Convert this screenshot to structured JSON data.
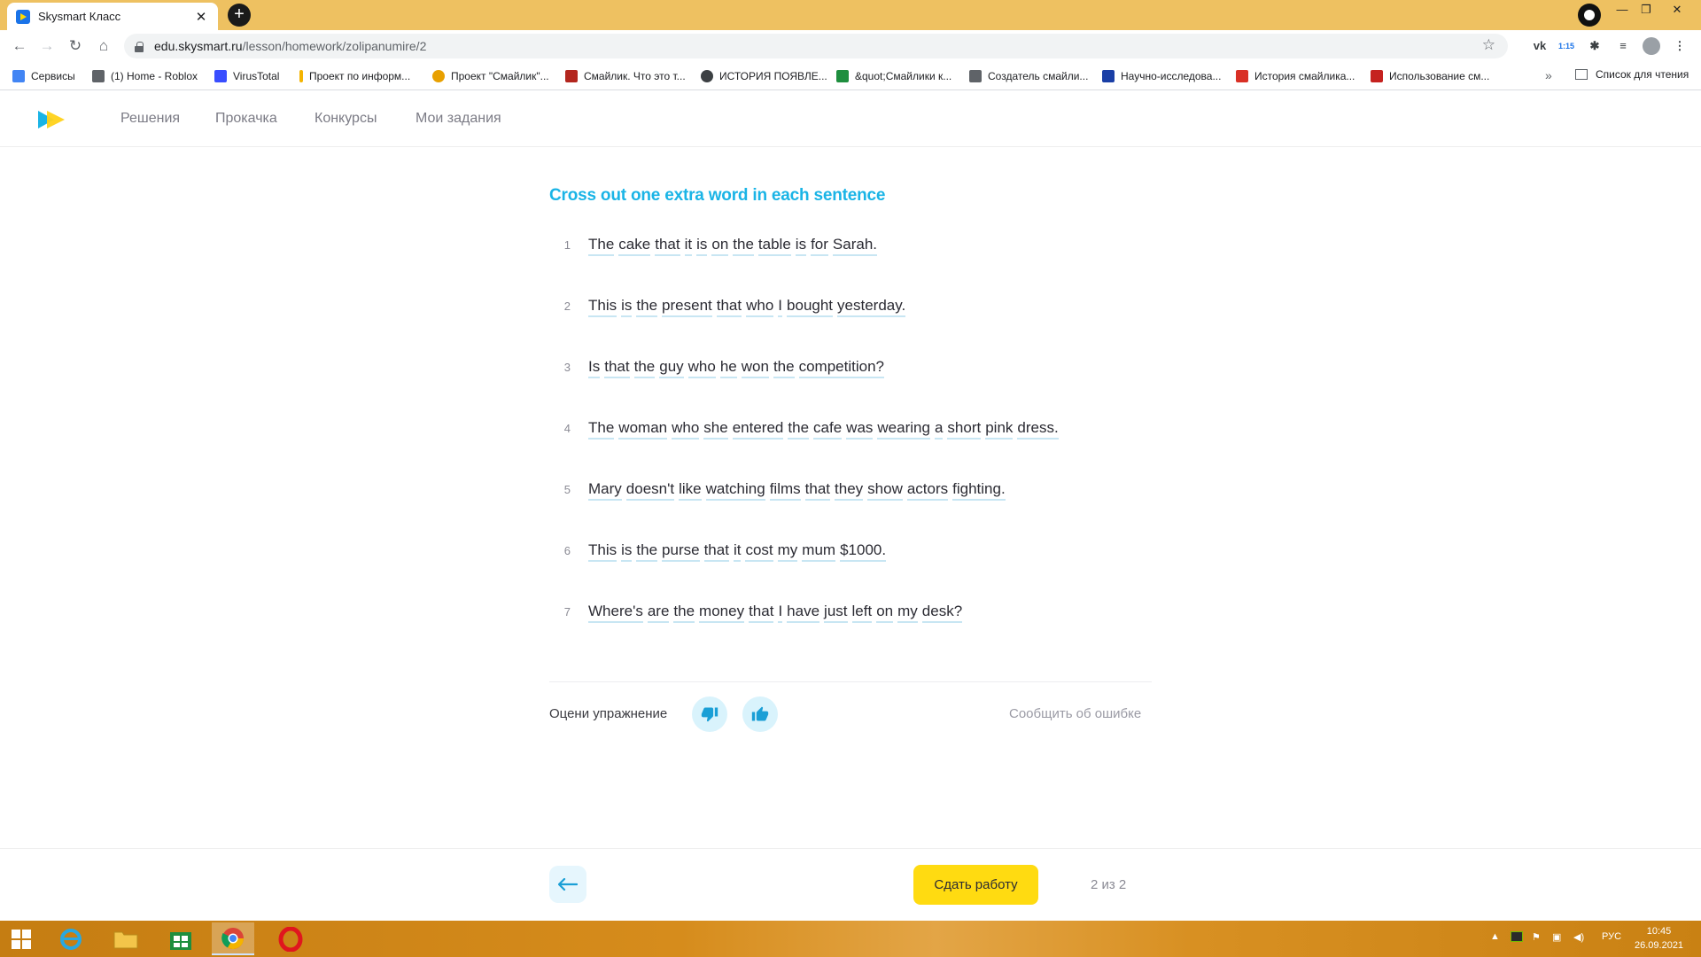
{
  "browser": {
    "tab_title": "Skysmart Класс",
    "tab_close": "✕",
    "new_tab": "+",
    "url_host": "edu.skysmart.ru",
    "url_path": "/lesson/homework/zolipanumire/2",
    "window_controls": [
      "—",
      "❐",
      "✕"
    ],
    "ext_badge": "1:15",
    "bookmarks": [
      {
        "label": "Сервисы",
        "color": "#4285f4"
      },
      {
        "label": "(1) Home - Roblox",
        "color": "#5f6368"
      },
      {
        "label": "VirusTotal",
        "color": "#394eff"
      },
      {
        "label": "Проект по информ...",
        "color": "#f4b400"
      },
      {
        "label": "Проект \"Смайлик\"...",
        "color": "#e8a000"
      },
      {
        "label": "Смайлик. Что это т...",
        "color": "#b3261e"
      },
      {
        "label": "ИСТОРИЯ ПОЯВЛЕ...",
        "color": "#3c4043"
      },
      {
        "label": "&quot;Смайлики к...",
        "color": "#1e8e3e"
      },
      {
        "label": "Создатель смайли...",
        "color": "#5f6368"
      },
      {
        "label": "Научно-исследова...",
        "color": "#1a3fa6"
      },
      {
        "label": "История смайлика...",
        "color": "#d93025"
      },
      {
        "label": "Использование см...",
        "color": "#c5221f"
      }
    ],
    "bookmarks_more": "»",
    "reading_list": "Список для чтения"
  },
  "site": {
    "nav": [
      "Решения",
      "Прокачка",
      "Конкурсы",
      "Мои задания"
    ]
  },
  "exercise": {
    "title": "Cross out one extra word in each sentence",
    "sentences": [
      {
        "num": "1",
        "words": [
          "The",
          "cake",
          "that",
          "it",
          "is",
          "on",
          "the",
          "table",
          "is",
          "for",
          "Sarah."
        ]
      },
      {
        "num": "2",
        "words": [
          "This",
          "is",
          "the",
          "present",
          "that",
          "who",
          "I",
          "bought",
          "yesterday."
        ]
      },
      {
        "num": "3",
        "words": [
          "Is",
          "that",
          "the",
          "guy",
          "who",
          "he",
          "won",
          "the",
          "competition?"
        ]
      },
      {
        "num": "4",
        "words": [
          "The",
          "woman",
          "who",
          "she",
          "entered",
          "the",
          "cafe",
          "was",
          "wearing",
          "a",
          "short",
          "pink",
          "dress."
        ]
      },
      {
        "num": "5",
        "words": [
          "Mary",
          "doesn't",
          "like",
          "watching",
          "films",
          "that",
          "they",
          "show",
          "actors",
          "fighting."
        ]
      },
      {
        "num": "6",
        "words": [
          "This",
          "is",
          "the",
          "purse",
          "that",
          "it",
          "cost",
          "my",
          "mum",
          "$1000."
        ]
      },
      {
        "num": "7",
        "words": [
          "Where's",
          "are",
          "the",
          "money",
          "that",
          "I",
          "have",
          "just",
          "left",
          "on",
          "my",
          "desk?"
        ]
      }
    ],
    "rate_label": "Оцени упражнение",
    "report_label": "Сообщить об ошибке"
  },
  "footer": {
    "submit_label": "Сдать работу",
    "page_counter": "2 из 2"
  },
  "taskbar": {
    "lang": "РУС",
    "time": "10:45",
    "date": "26.09.2021",
    "tray_arrow": "▲"
  },
  "colors": {
    "accent": "#1ab4e6",
    "submit": "#ffdb11",
    "chrome_frame": "#eec161"
  }
}
